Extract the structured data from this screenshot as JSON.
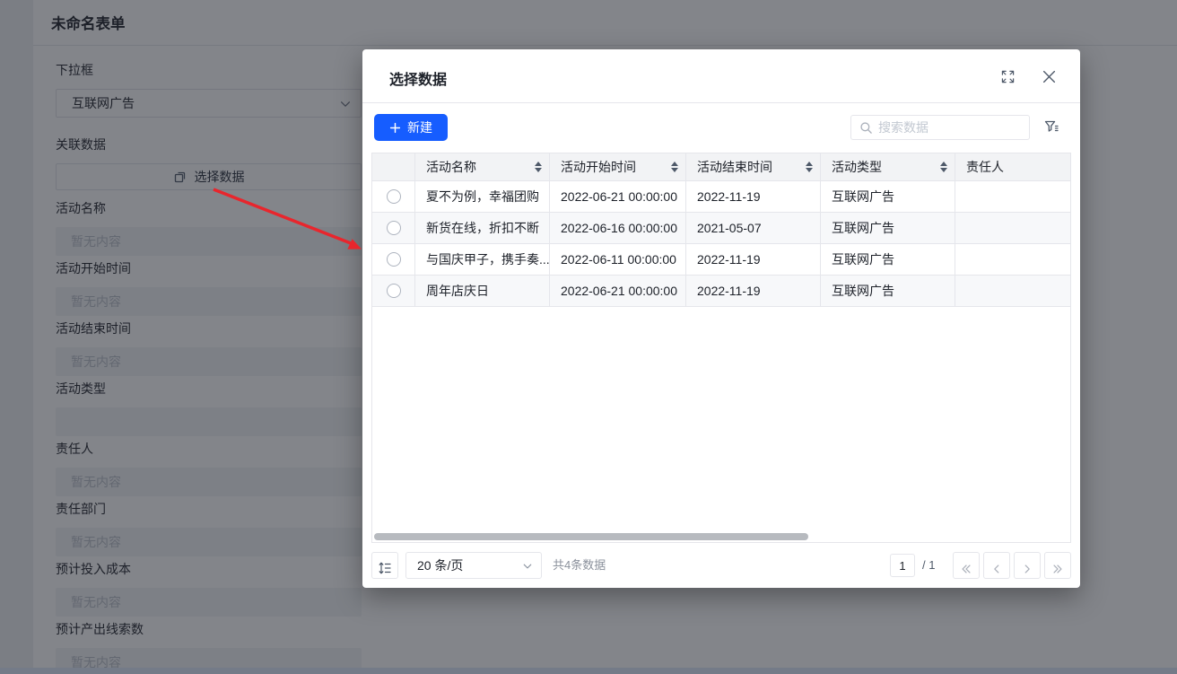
{
  "page": {
    "title": "未命名表单",
    "fields": [
      {
        "label": "下拉框",
        "value": "互联网广告"
      },
      {
        "label": "关联数据",
        "button": "选择数据"
      },
      {
        "label": "活动名称",
        "placeholder": "暂无内容"
      },
      {
        "label": "活动开始时间",
        "placeholder": "暂无内容"
      },
      {
        "label": "活动结束时间",
        "placeholder": "暂无内容"
      },
      {
        "label": "活动类型",
        "placeholder": ""
      },
      {
        "label": "责任人",
        "placeholder": "暂无内容"
      },
      {
        "label": "责任部门",
        "placeholder": "暂无内容"
      },
      {
        "label": "预计投入成本",
        "placeholder": "暂无内容"
      },
      {
        "label": "预计产出线索数",
        "placeholder": "暂无内容"
      }
    ]
  },
  "modal": {
    "title": "选择数据",
    "toolbar": {
      "new_button": "新建",
      "search_placeholder": "搜索数据"
    },
    "table": {
      "columns": [
        "",
        "活动名称",
        "活动开始时间",
        "活动结束时间",
        "活动类型",
        "责任人"
      ],
      "rows": [
        {
          "name": "夏不为例，幸福团购",
          "start": "2022-06-21 00:00:00",
          "end": "2022-11-19",
          "type": "互联网广告",
          "owner": ""
        },
        {
          "name": "新货在线，折扣不断",
          "start": "2022-06-16 00:00:00",
          "end": "2021-05-07",
          "type": "互联网广告",
          "owner": ""
        },
        {
          "name": "与国庆甲子，携手奏...",
          "start": "2022-06-11 00:00:00",
          "end": "2022-11-19",
          "type": "互联网广告",
          "owner": ""
        },
        {
          "name": "周年店庆日",
          "start": "2022-06-21 00:00:00",
          "end": "2022-11-19",
          "type": "互联网广告",
          "owner": ""
        }
      ]
    },
    "footer": {
      "page_size": "20 条/页",
      "total": "共4条数据",
      "page": "1",
      "page_indicator": "/ 1"
    }
  },
  "colors": {
    "primary": "#165dff",
    "overlay": "rgba(29,33,41,0.55)",
    "arrow_red": "#e8262d",
    "border": "#e5e6eb",
    "header_bg": "#f2f3f5",
    "zebra_bg": "#f7f8fa"
  }
}
